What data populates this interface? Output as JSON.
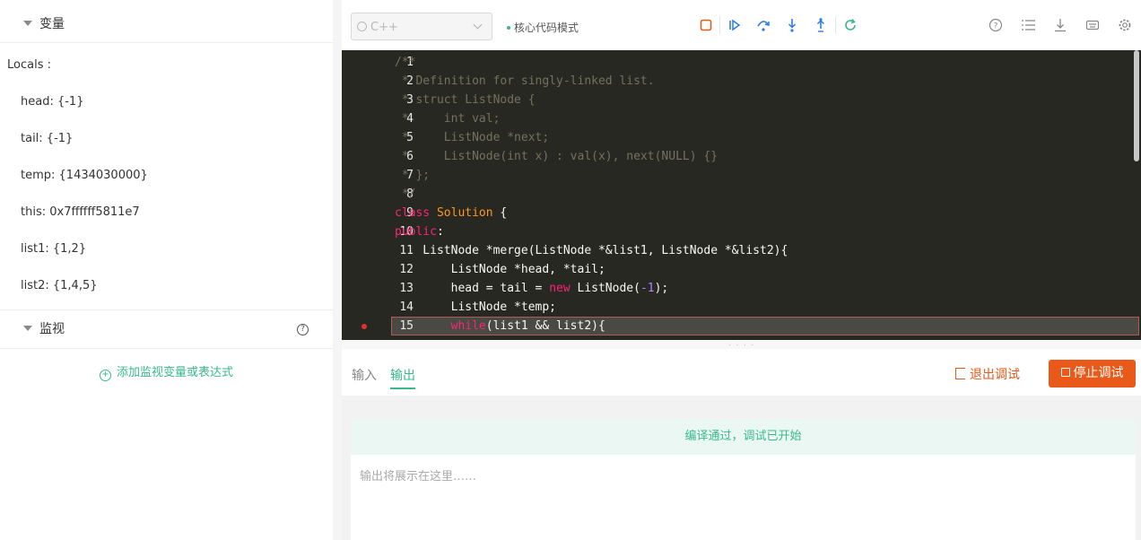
{
  "left_panel": {
    "variables_title": "变量",
    "locals_label": "Locals :",
    "variables": [
      "head: {-1}",
      "tail: {-1}",
      "temp: {1434030000}",
      "this: 0x7ffffff5811e7",
      "list1: {1,2}",
      "list2: {1,4,5}"
    ],
    "watch_title": "监视",
    "add_watch": "添加监视变量或表达式"
  },
  "toolbar": {
    "language": "C++",
    "mode": "核心代码模式",
    "icons": [
      "stop-debug-icon",
      "continue-icon",
      "step-over-icon",
      "step-into-icon",
      "step-out-icon",
      "restart-icon",
      "help-icon",
      "list-icon",
      "download-icon",
      "keyboard-icon",
      "settings-icon"
    ]
  },
  "editor": {
    "lines": [
      "1",
      "2",
      "3",
      "4",
      "5",
      "6",
      "7",
      "8",
      "9",
      "10",
      "11",
      "12",
      "13",
      "14",
      "15"
    ],
    "code": {
      "l1": "/**",
      "l2": " * Definition for singly-linked list.",
      "l3": " * struct ListNode {",
      "l4": " *     int val;",
      "l5": " *     ListNode *next;",
      "l6": " *     ListNode(int x) : val(x), next(NULL) {}",
      "l7": " * };",
      "l8": " */",
      "l9_kw": "class",
      "l9_name": "Solution",
      "l9_rest": " {",
      "l10_kw": "public",
      "l10_rest": ":",
      "l11": "    ListNode *merge(ListNode *&list1, ListNode *&list2){",
      "l12": "        ListNode *head, *tail;",
      "l13_a": "        head = tail = ",
      "l13_kw": "new",
      "l13_b": " ListNode(",
      "l13_num": "-1",
      "l13_c": ");",
      "l14": "        ListNode *temp;",
      "l15_indent": "        ",
      "l15_kw": "while",
      "l15_rest": "(list1 && list2){"
    }
  },
  "bottom": {
    "tab_input": "输入",
    "tab_output": "输出",
    "exit_debug": "退出调试",
    "stop_debug": "停止调试",
    "status": "编译通过，调试已开始",
    "output_placeholder": "输出将展示在这里……"
  },
  "colors": {
    "accent_green": "#39b98a",
    "accent_orange": "#e8591a",
    "editor_bg": "#272822"
  }
}
